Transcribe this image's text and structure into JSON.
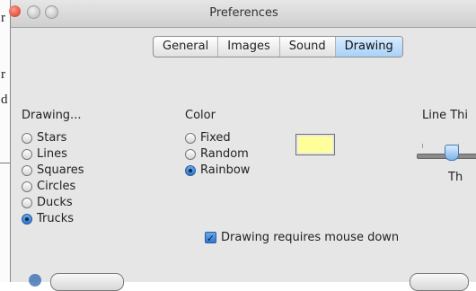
{
  "doc_strip": {
    "chars": [
      "r",
      "r",
      "d"
    ]
  },
  "window": {
    "title": "Preferences",
    "tabs": [
      {
        "label": "General",
        "active": false
      },
      {
        "label": "Images",
        "active": false
      },
      {
        "label": "Sound",
        "active": false
      },
      {
        "label": "Drawing",
        "active": true
      }
    ]
  },
  "drawing": {
    "label": "Drawing...",
    "options": [
      {
        "label": "Stars",
        "selected": false
      },
      {
        "label": "Lines",
        "selected": false
      },
      {
        "label": "Squares",
        "selected": false
      },
      {
        "label": "Circles",
        "selected": false
      },
      {
        "label": "Ducks",
        "selected": false
      },
      {
        "label": "Trucks",
        "selected": true
      }
    ]
  },
  "color": {
    "label": "Color",
    "options": [
      {
        "label": "Fixed",
        "selected": false
      },
      {
        "label": "Random",
        "selected": false
      },
      {
        "label": "Rainbow",
        "selected": true
      }
    ],
    "swatch_color": "#ffff99"
  },
  "line_thickness": {
    "label": "Line Thi",
    "sub_label": "Th"
  },
  "mouse_down": {
    "label": "Drawing requires mouse down",
    "checked": true
  },
  "colors": {
    "accent": "#2f77cf",
    "tab_active": "#a9d1f7"
  }
}
